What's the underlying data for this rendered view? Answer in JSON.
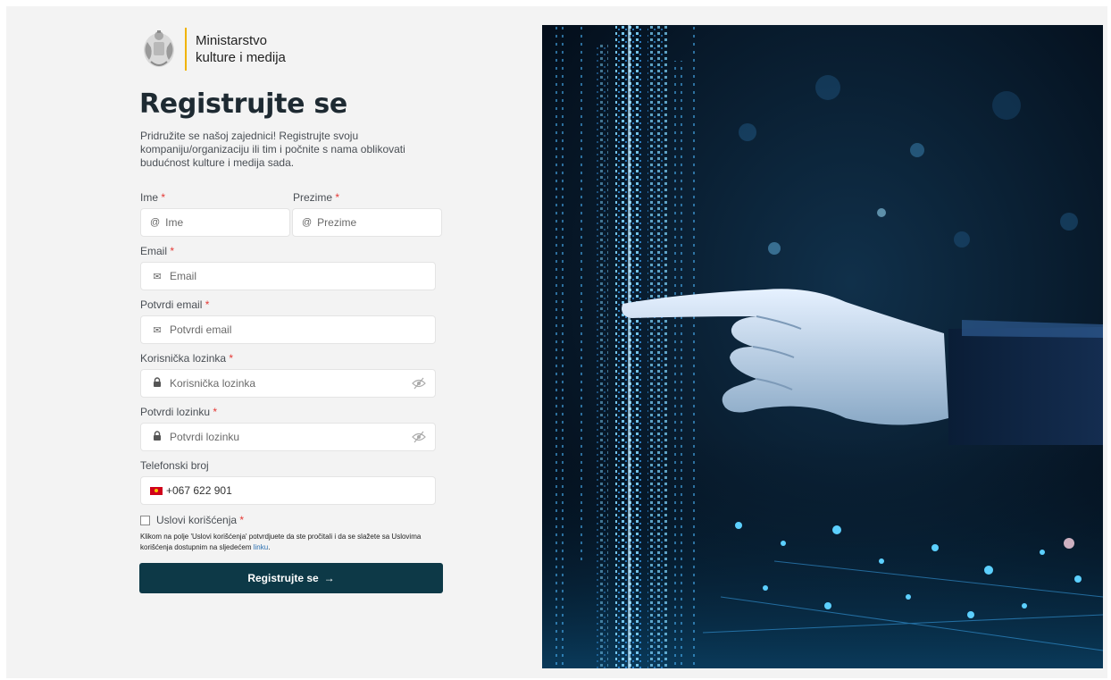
{
  "brand": {
    "line1": "Ministarstvo",
    "line2": "kulture i medija"
  },
  "page": {
    "title": "Registrujte se",
    "subtitle": "Pridružite se našoj zajednici! Registrujte svoju kompaniju/organizaciju ili tim i počnite s nama oblikovati budućnost kulture i medija sada."
  },
  "form": {
    "first_name": {
      "label": "Ime",
      "placeholder": "Ime",
      "icon": "at-icon"
    },
    "last_name": {
      "label": "Prezime",
      "placeholder": "Prezime",
      "icon": "at-icon"
    },
    "email": {
      "label": "Email",
      "placeholder": "Email",
      "icon": "envelope-icon"
    },
    "confirm_email": {
      "label": "Potvrdi email",
      "placeholder": "Potvrdi email",
      "icon": "envelope-icon"
    },
    "password": {
      "label": "Korisnička lozinka",
      "placeholder": "Korisnička lozinka",
      "icon": "lock-icon",
      "toggle_icon": "eye-slash-icon"
    },
    "confirm_password": {
      "label": "Potvrdi lozinku",
      "placeholder": "Potvrdi lozinku",
      "icon": "lock-icon",
      "toggle_icon": "eye-slash-icon"
    },
    "phone": {
      "label": "Telefonski broj",
      "value": "+067 622 901",
      "flag": "montenegro-flag-icon"
    },
    "required_marker": "*",
    "terms": {
      "label": "Uslovi korišćenja",
      "checked": false,
      "note_prefix": "Klikom na polje 'Uslovi korišćenja' potvrdjuete da ste pročitali i da se slažete sa Uslovima korišćenja dostupnim na sljedećem",
      "note_link": "linku",
      "note_suffix": "."
    },
    "submit_label": "Registrujte se",
    "submit_icon": "→"
  },
  "colors": {
    "accent": "#0d3947",
    "brand_divider": "#f0b400",
    "required": "#e53935",
    "background": "#f3f3f3"
  }
}
